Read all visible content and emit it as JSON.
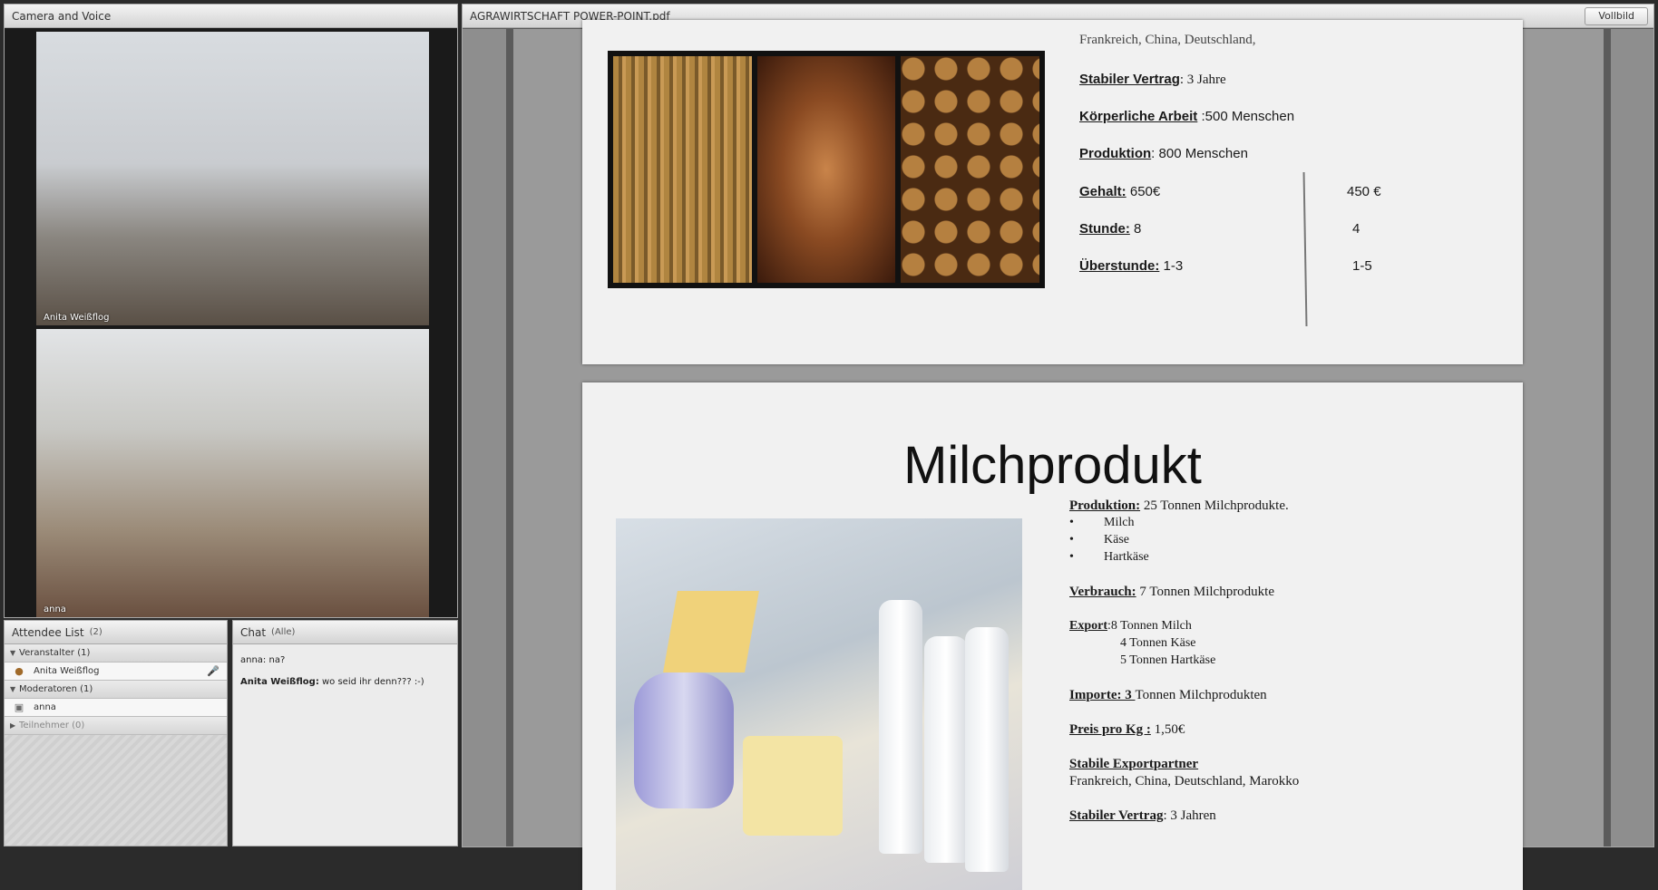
{
  "camera": {
    "title": "Camera and Voice",
    "video1_name": "Anita  Weißflog",
    "video2_name": "anna"
  },
  "attendees": {
    "title": "Attendee List",
    "count": "(2)",
    "groups": [
      {
        "label": "Veranstalter (1)"
      },
      {
        "label": "Moderatoren (1)"
      },
      {
        "label": "Teilnehmer (0)"
      }
    ],
    "host": "Anita  Weißflog",
    "moderator": "anna"
  },
  "chat": {
    "title": "Chat",
    "scope": "(Alle)",
    "messages": [
      {
        "author": "anna:",
        "text": " na?"
      },
      {
        "author": "Anita  Weißflog:",
        "text": " wo seid ihr denn??? :-)"
      }
    ]
  },
  "share": {
    "title": "AGRAWIRTSCHAFT POWER-POINT.pdf",
    "fullscreen_label": "Vollbild"
  },
  "page1": {
    "top_line": "Frankreich, China, Deutschland,",
    "contract_label": "Stabiler Vertrag",
    "contract_value": ": 3 Jahre",
    "work_label": "Körperliche Arbeit",
    "work_value": " :500 Menschen",
    "prod_label": "Produktion",
    "prod_value": ": 800 Menschen",
    "salary_label": "Gehalt:",
    "salary_value": "  650€",
    "salary_value2": "450 €",
    "hours_label": "Stunde:",
    "hours_value": " 8",
    "hours_value2": "4",
    "overtime_label": "Überstunde:",
    "overtime_value": " 1-3",
    "overtime_value2": "1-5"
  },
  "page2": {
    "title": "Milchprodukt",
    "prod_label": "Produktion:",
    "prod_value": "  25 Tonnen Milchprodukte.",
    "bullets": [
      "Milch",
      "Käse",
      "Hartkäse"
    ],
    "bullet_char": "•",
    "consumption_label": "Verbrauch:",
    "consumption_value": " 7 Tonnen Milchprodukte",
    "export_label": "Export",
    "export_lines": [
      ":8 Tonnen Milch",
      "4 Tonnen Käse",
      "5 Tonnen Hartkäse"
    ],
    "import_label": "Importe:  3 ",
    "import_value": " Tonnen Milchprodukten",
    "price_label": "Preis pro Kg :",
    "price_value": " 1,50€",
    "partners_label": "Stabile Exportpartner",
    "partners_value": "Frankreich, China, Deutschland, Marokko",
    "contract_label": "Stabiler Vertrag",
    "contract_value": ": 3 Jahren"
  }
}
